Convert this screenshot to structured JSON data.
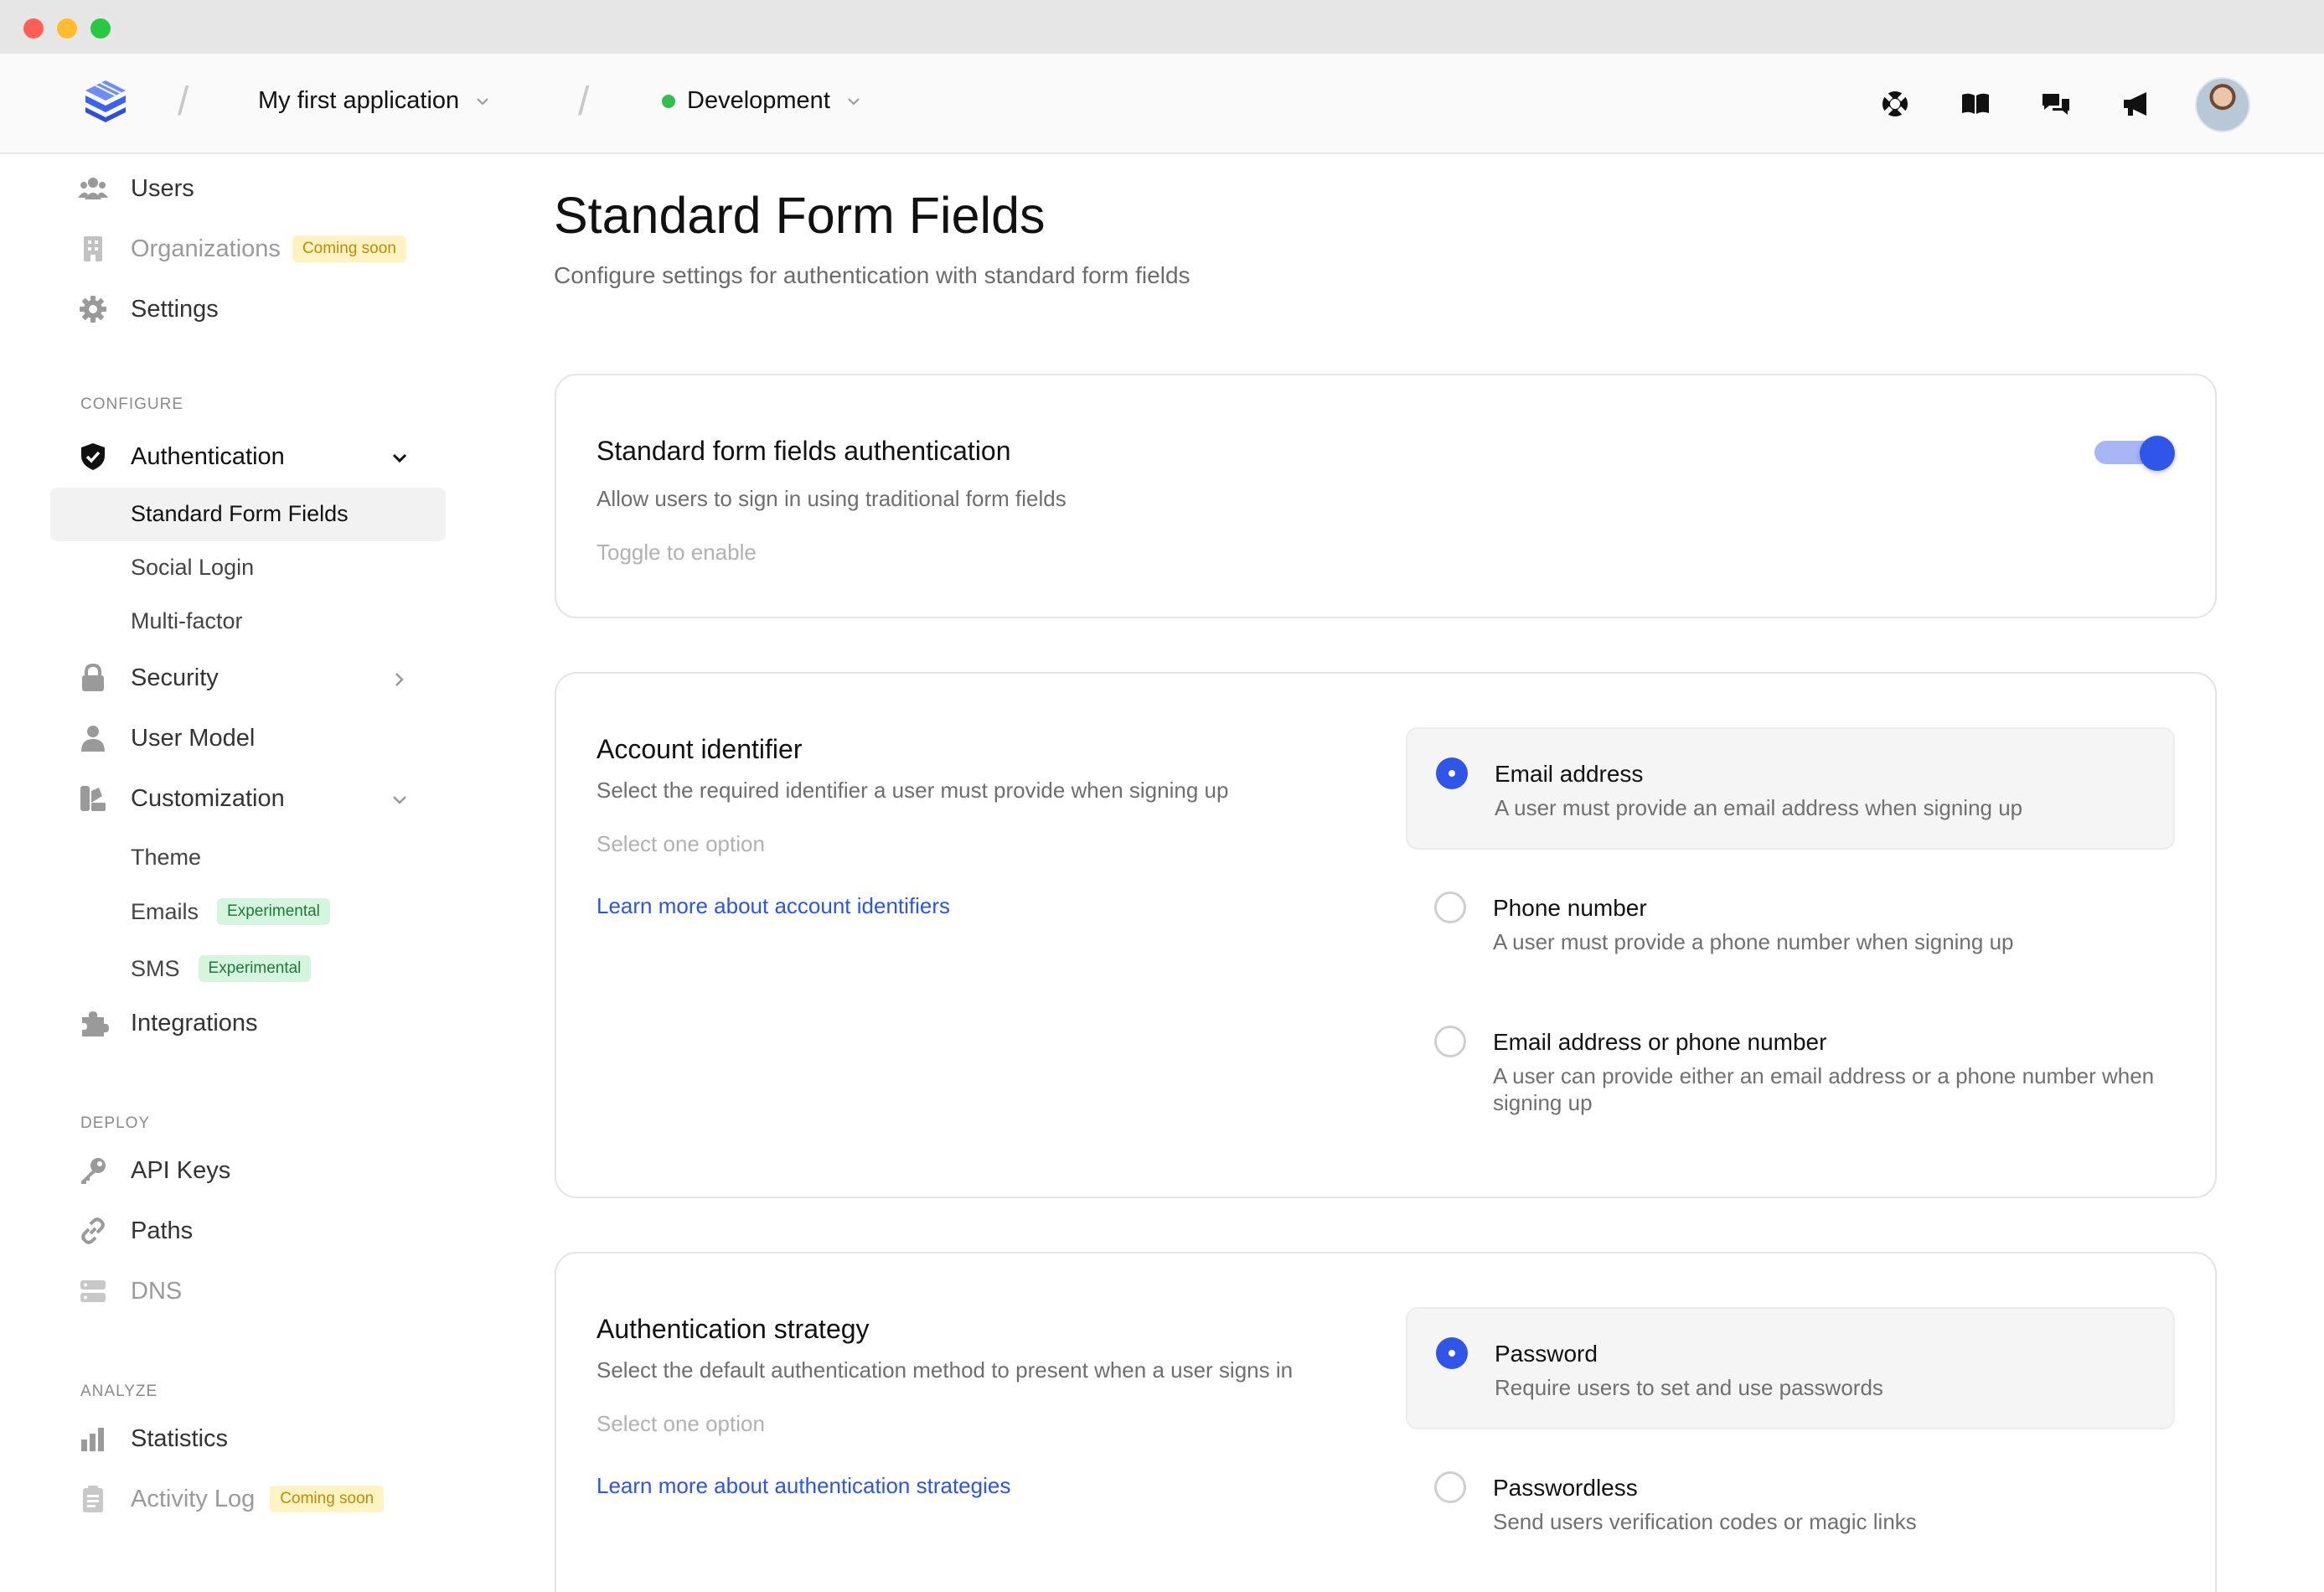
{
  "header": {
    "app_name": "My first application",
    "environment": "Development"
  },
  "sidebar": {
    "top_items": [
      {
        "label": "Users"
      },
      {
        "label": "Organizations",
        "badge": "Coming soon"
      },
      {
        "label": "Settings"
      }
    ],
    "configure_label": "CONFIGURE",
    "authentication": {
      "label": "Authentication",
      "children": [
        "Standard Form Fields",
        "Social Login",
        "Multi-factor"
      ]
    },
    "security_label": "Security",
    "user_model_label": "User Model",
    "customization": {
      "label": "Customization",
      "children": [
        {
          "label": "Theme"
        },
        {
          "label": "Emails",
          "badge": "Experimental"
        },
        {
          "label": "SMS",
          "badge": "Experimental"
        }
      ]
    },
    "integrations_label": "Integrations",
    "deploy_label": "DEPLOY",
    "deploy_items": [
      "API Keys",
      "Paths",
      "DNS"
    ],
    "analyze_label": "ANALYZE",
    "analyze_items": [
      {
        "label": "Statistics"
      },
      {
        "label": "Activity Log",
        "badge": "Coming soon"
      }
    ]
  },
  "main": {
    "title": "Standard Form Fields",
    "subtitle": "Configure settings for authentication with standard form fields",
    "sff_card": {
      "title": "Standard form fields authentication",
      "description": "Allow users to sign in using traditional form fields",
      "hint": "Toggle to enable",
      "enabled": true
    },
    "identifier_card": {
      "title": "Account identifier",
      "description": "Select the required identifier a user must provide when signing up",
      "hint": "Select one option",
      "link": "Learn more about account identifiers",
      "options": [
        {
          "title": "Email address",
          "description": "A user must provide an email address when signing up",
          "selected": true
        },
        {
          "title": "Phone number",
          "description": "A user must provide a phone number when signing up",
          "selected": false
        },
        {
          "title": "Email address or phone number",
          "description": "A user can provide either an email address or a phone number when signing up",
          "selected": false
        }
      ]
    },
    "strategy_card": {
      "title": "Authentication strategy",
      "description": "Select the default authentication method to present when a user signs in",
      "hint": "Select one option",
      "link": "Learn more about authentication strategies",
      "options": [
        {
          "title": "Password",
          "description": "Require users to set and use passwords",
          "selected": true
        },
        {
          "title": "Passwordless",
          "description": "Send users verification codes or magic links",
          "selected": false
        }
      ]
    }
  },
  "colors": {
    "accent": "#2f56e8",
    "env_dot": "#2fbf4a",
    "badge_soon_bg": "#fff3c4",
    "badge_exp_bg": "#d6f5de",
    "link": "#2b55e6"
  }
}
